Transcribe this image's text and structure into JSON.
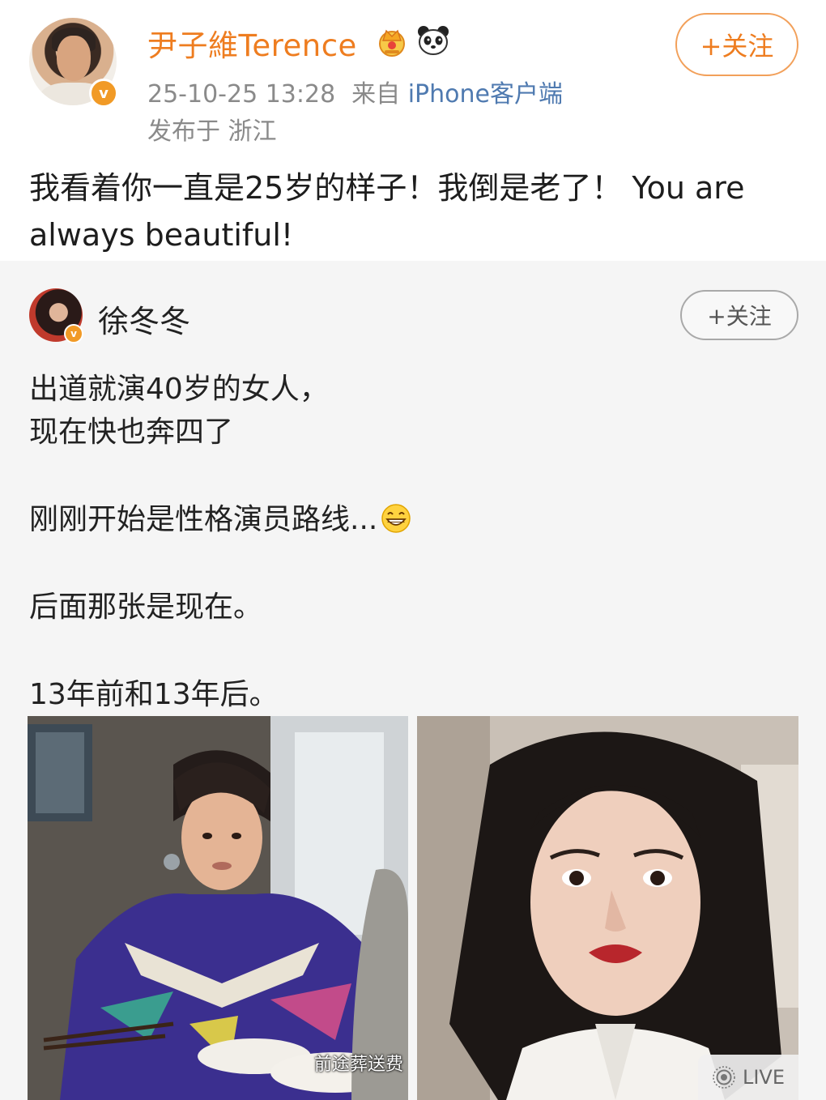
{
  "post": {
    "username": "尹子維Terence",
    "timestamp": "25-10-25 13:28",
    "source_prefix": "来自",
    "source": "iPhone客户端",
    "location": "发布于 浙江",
    "follow_label": "+关注",
    "text": "我看着你一直是25岁的样子！我倒是老了！ You are always beautiful!",
    "icons": {
      "avatar": "user-avatar",
      "verified": "verified-v-icon",
      "crown": "crown-vip-icon",
      "panda": "panda-icon"
    },
    "accent_color": "#ee7d20"
  },
  "repost": {
    "username": "徐冬冬",
    "follow_label": "+关注",
    "lines": [
      "出道就演40岁的女人，",
      "现在快也奔四了",
      "刚刚开始是性格演员路线...",
      "后面那张是现在。",
      "13年前和13年后。"
    ],
    "emoji": "grinning-face-icon",
    "images": [
      {
        "name": "photo-then",
        "caption": "前途葬送费"
      },
      {
        "name": "photo-now",
        "badge": "LIVE"
      }
    ]
  }
}
